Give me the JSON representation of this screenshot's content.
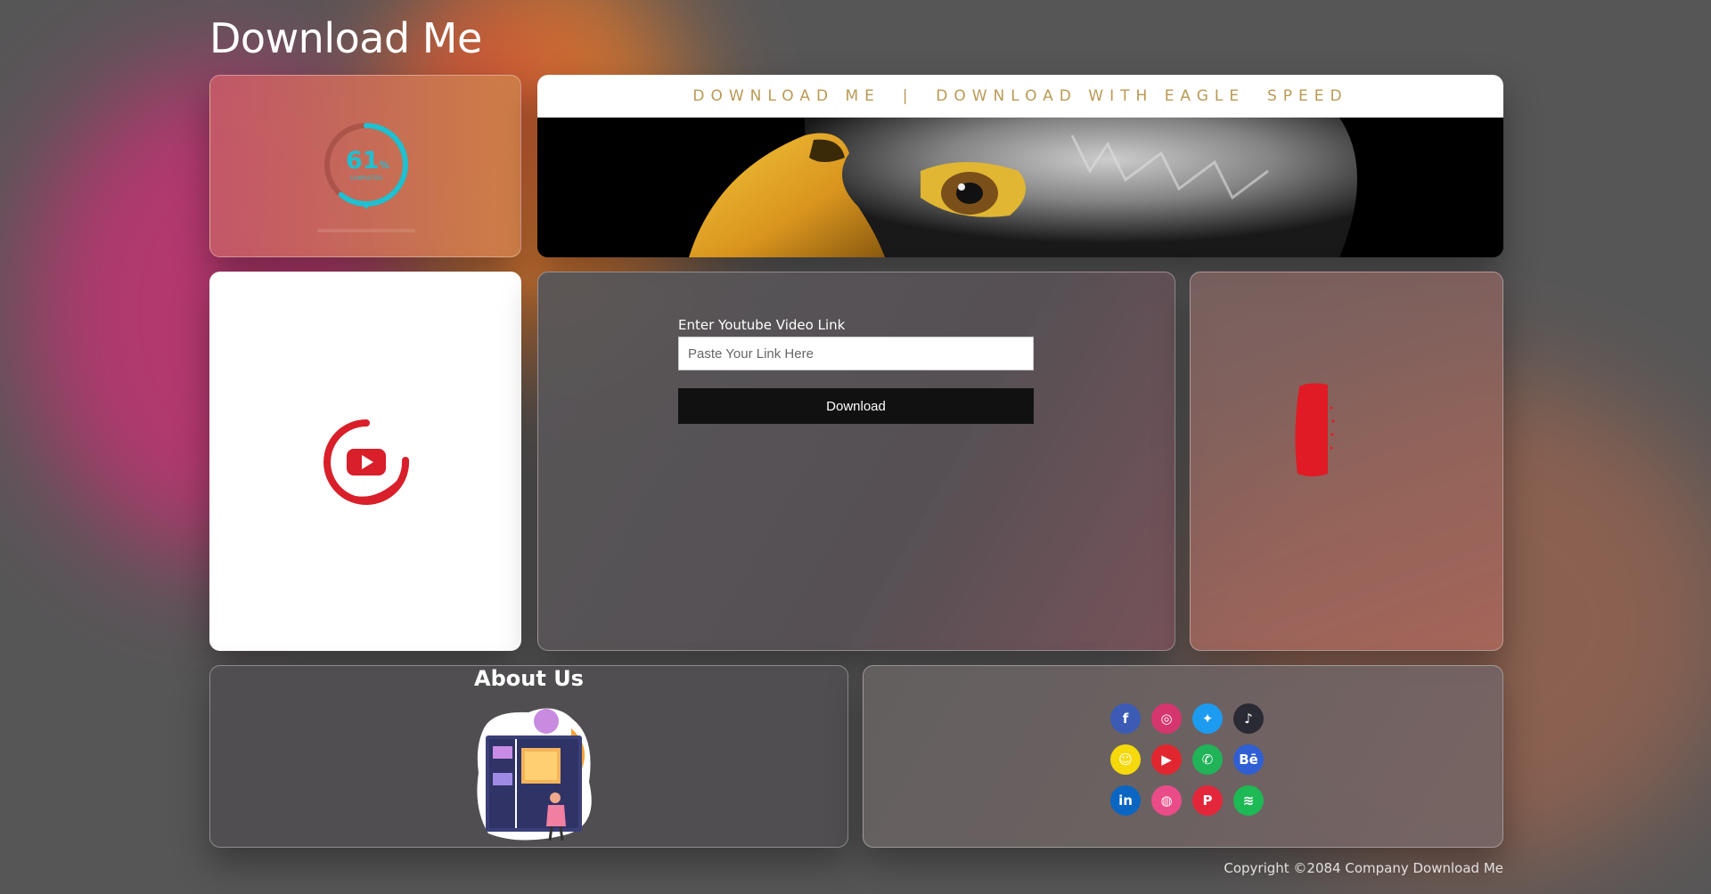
{
  "page": {
    "title": "Download Me"
  },
  "progress": {
    "value": "61",
    "unit": "%",
    "label": "COMPLETED",
    "percent": 61
  },
  "banner": {
    "text": "DOWNLOAD ME  |  DOWNLOAD WITH EAGLE  SPEED"
  },
  "form": {
    "label": "Enter Youtube Video Link",
    "placeholder": "Paste Your Link Here",
    "button_label": "Download"
  },
  "about": {
    "title": "About Us"
  },
  "social": {
    "icons": [
      {
        "name": "facebook-icon",
        "glyph": "f",
        "color": "#3b5bb5"
      },
      {
        "name": "instagram-icon",
        "glyph": "◎",
        "color": "#d6366e"
      },
      {
        "name": "twitter-icon",
        "glyph": "✦",
        "color": "#1d9bf0"
      },
      {
        "name": "tiktok-icon",
        "glyph": "♪",
        "color": "#2a2a34"
      },
      {
        "name": "snapchat-icon",
        "glyph": "☺",
        "color": "#f5d90a"
      },
      {
        "name": "youtube-icon",
        "glyph": "▶",
        "color": "#e1262f"
      },
      {
        "name": "whatsapp-icon",
        "glyph": "✆",
        "color": "#20b358"
      },
      {
        "name": "behance-icon",
        "glyph": "Bē",
        "color": "#2f5fd3"
      },
      {
        "name": "linkedin-icon",
        "glyph": "in",
        "color": "#0a66c2"
      },
      {
        "name": "dribbble-icon",
        "glyph": "◍",
        "color": "#ea4c89"
      },
      {
        "name": "pinterest-icon",
        "glyph": "P",
        "color": "#e3263a"
      },
      {
        "name": "spotify-icon",
        "glyph": "≋",
        "color": "#1db954"
      }
    ]
  },
  "footer": {
    "copyright": "Copyright ©2084 Company Download Me"
  }
}
